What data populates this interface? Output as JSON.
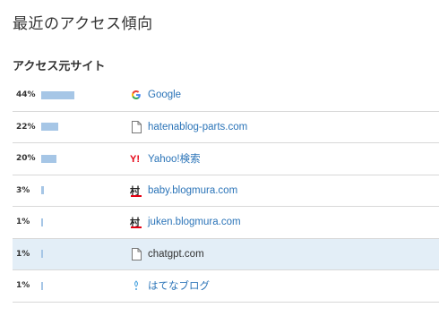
{
  "page": {
    "title": "最近のアクセス傾向",
    "section_title": "アクセス元サイト"
  },
  "colors": {
    "bar": "#a6c6e6",
    "link": "#2b74b8",
    "highlight_row": "#e3eef7"
  },
  "sites": [
    {
      "percent_label": "44%",
      "percent": 44,
      "name": "Google",
      "icon": "google-icon",
      "link": true
    },
    {
      "percent_label": "22%",
      "percent": 22,
      "name": "hatenablog-parts.com",
      "icon": "document-icon",
      "link": true
    },
    {
      "percent_label": "20%",
      "percent": 20,
      "name": "Yahoo!検索",
      "icon": "yahoo-icon",
      "link": true
    },
    {
      "percent_label": "3%",
      "percent": 3,
      "name": "baby.blogmura.com",
      "icon": "blogmura-icon",
      "link": true
    },
    {
      "percent_label": "1%",
      "percent": 1,
      "name": "juken.blogmura.com",
      "icon": "blogmura-icon",
      "link": true
    },
    {
      "percent_label": "1%",
      "percent": 1,
      "name": "chatgpt.com",
      "icon": "document-icon",
      "link": false,
      "highlighted": true
    },
    {
      "percent_label": "1%",
      "percent": 1,
      "name": "はてなブログ",
      "icon": "hatena-icon",
      "link": true
    }
  ]
}
